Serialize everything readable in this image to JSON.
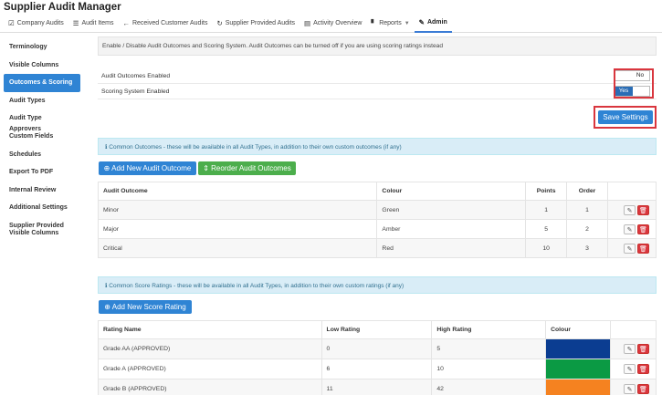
{
  "app": {
    "title": "Supplier Audit Manager"
  },
  "nav": [
    {
      "label": "Company Audits",
      "icon": "check-square-icon",
      "glyph": "☑"
    },
    {
      "label": "Audit Items",
      "icon": "list-icon",
      "glyph": "☰"
    },
    {
      "label": "Received Customer Audits",
      "icon": "arrow-left-icon",
      "glyph": "←"
    },
    {
      "label": "Supplier Provided Audits",
      "icon": "refresh-icon",
      "glyph": "↻"
    },
    {
      "label": "Activity Overview",
      "icon": "grid-icon",
      "glyph": "▤"
    },
    {
      "label": "Reports",
      "icon": "file-icon",
      "glyph": "▘"
    },
    {
      "label": "Admin",
      "icon": "wrench-icon",
      "glyph": "✎"
    }
  ],
  "sidebar": [
    {
      "label": "Terminology"
    },
    {
      "label": "Visible Columns"
    },
    {
      "label": "Outcomes & Scoring"
    },
    {
      "label": "Audit Types"
    },
    {
      "label": "Audit Type Approvers"
    },
    {
      "label": "Custom Fields"
    },
    {
      "label": "Schedules"
    },
    {
      "label": "Export To PDF"
    },
    {
      "label": "Internal Review"
    },
    {
      "label": "Additional Settings"
    },
    {
      "label": "Supplier Provided Visible Columns"
    }
  ],
  "settings": {
    "description": "Enable / Disable Audit Outcomes and Scoring System. Audit Outcomes can be turned off if you are using scoring ratings instead",
    "outcomes_label": "Audit Outcomes Enabled",
    "outcomes_value": "No",
    "scoring_label": "Scoring System Enabled",
    "scoring_value": "Yes",
    "save_label": "Save Settings"
  },
  "outcomes": {
    "info": "Common Outcomes - these will be available in all Audit Types, in addition to their own custom outcomes (if any)",
    "add_label": "Add New Audit Outcome",
    "reorder_label": "Reorder Audit Outcomes",
    "headers": [
      "Audit Outcome",
      "Colour",
      "Points",
      "Order"
    ],
    "rows": [
      {
        "name": "Minor",
        "colour": "Green",
        "points": "1",
        "order": "1"
      },
      {
        "name": "Major",
        "colour": "Amber",
        "points": "5",
        "order": "2"
      },
      {
        "name": "Critical",
        "colour": "Red",
        "points": "10",
        "order": "3"
      }
    ]
  },
  "ratings": {
    "info": "Common Score Ratings - these will be available in all Audit Types, in addition to their own custom ratings (if any)",
    "add_label": "Add New Score Rating",
    "headers": [
      "Rating Name",
      "Low Rating",
      "High Rating",
      "Colour"
    ],
    "rows": [
      {
        "name": "Grade AA (APPROVED)",
        "low": "0",
        "high": "5",
        "color": "#0b3d91"
      },
      {
        "name": "Grade A (APPROVED)",
        "low": "6",
        "high": "10",
        "color": "#0b9a44"
      },
      {
        "name": "Grade B (APPROVED)",
        "low": "11",
        "high": "42",
        "color": "#f58220"
      }
    ]
  },
  "colors": {
    "primary": "#2f84d4",
    "success": "#4cae4c",
    "danger": "#d9363e",
    "info_bg": "#d9edf7"
  }
}
